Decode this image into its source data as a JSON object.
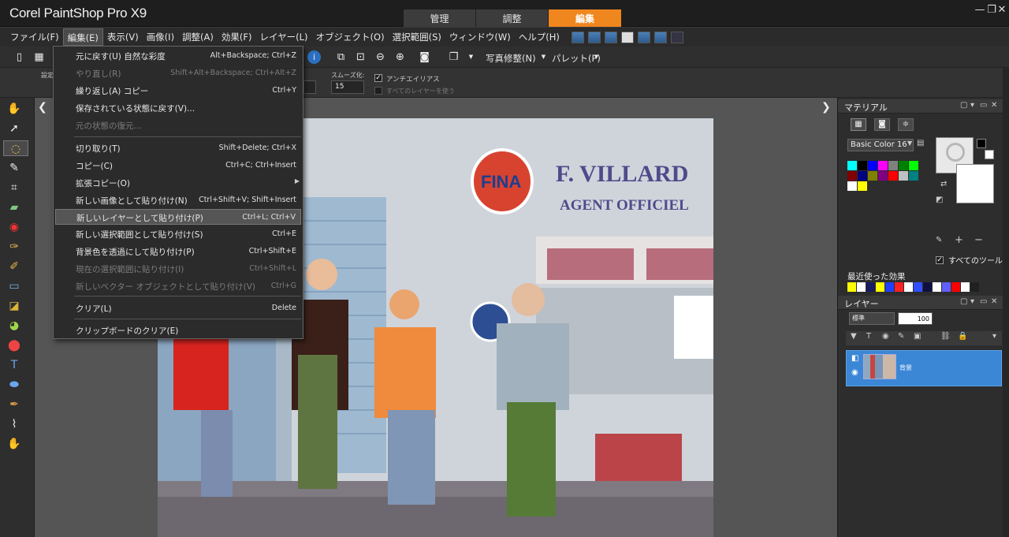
{
  "app": {
    "title": "Corel PaintShop Pro X9",
    "workspace_tabs": [
      {
        "label": "管理"
      },
      {
        "label": "調整"
      },
      {
        "label": "編集"
      }
    ],
    "window_controls": {
      "min": "—",
      "max": "❐",
      "close": "✕"
    }
  },
  "menubar": [
    "ファイル(F)",
    "編集(E)",
    "表示(V)",
    "画像(I)",
    "調整(A)",
    "効果(F)",
    "レイヤー(L)",
    "オブジェクト(O)",
    "選択範囲(S)",
    "ウィンドウ(W)",
    "ヘルプ(H)"
  ],
  "toolbar": {
    "photo_fix": "写真修整(N)",
    "palette": "パレット(P)"
  },
  "options": {
    "preset": "設定",
    "smooth_label": "スムーズ化:",
    "smooth_value": "15",
    "antialias": "アンチエイリアス",
    "use_all_layers": "すべてのレイヤーを使う"
  },
  "edit_menu": [
    {
      "label": "元に戻す(U) 自然な彩度",
      "shortcut": "Alt+Backspace; Ctrl+Z",
      "disabled": false
    },
    {
      "label": "やり直し(R)",
      "shortcut": "Shift+Alt+Backspace; Ctrl+Alt+Z",
      "disabled": true
    },
    {
      "label": "繰り返し(A) コピー",
      "shortcut": "Ctrl+Y",
      "disabled": false
    },
    {
      "label": "保存されている状態に戻す(V)...",
      "shortcut": "",
      "disabled": false
    },
    {
      "label": "元の状態の復元...",
      "shortcut": "",
      "disabled": true
    },
    {
      "label": "切り取り(T)",
      "shortcut": "Shift+Delete; Ctrl+X",
      "disabled": false
    },
    {
      "label": "コピー(C)",
      "shortcut": "Ctrl+C; Ctrl+Insert",
      "disabled": false
    },
    {
      "label": "拡張コピー(O)",
      "shortcut": "",
      "disabled": false
    },
    {
      "label": "新しい画像として貼り付け(N)",
      "shortcut": "Ctrl+Shift+V; Shift+Insert",
      "disabled": false
    },
    {
      "label": "新しいレイヤーとして貼り付け(P)",
      "shortcut": "Ctrl+L; Ctrl+V",
      "disabled": false
    },
    {
      "label": "新しい選択範囲として貼り付け(S)",
      "shortcut": "Ctrl+E",
      "disabled": false
    },
    {
      "label": "背景色を透過にして貼り付け(P)",
      "shortcut": "Ctrl+Shift+E",
      "disabled": false
    },
    {
      "label": "現在の選択範囲に貼り付け(I)",
      "shortcut": "Ctrl+Shift+L",
      "disabled": true
    },
    {
      "label": "新しいベクター オブジェクトとして貼り付け(V)",
      "shortcut": "Ctrl+G",
      "disabled": true
    },
    {
      "label": "クリア(L)",
      "shortcut": "Delete",
      "disabled": false
    },
    {
      "label": "クリップボードのクリア(E)",
      "shortcut": "",
      "disabled": false
    }
  ],
  "materials": {
    "title": "マテリアル",
    "palette_select": "Basic Color 16",
    "all_tools": "すべてのツール",
    "swatches": [
      "#00ffff",
      "#000000",
      "#0000ff",
      "#ff00ff",
      "#808080",
      "#008000",
      "#00ff00",
      "#800000",
      "#000080",
      "#808000",
      "#800080",
      "#ff0000",
      "#c0c0c0",
      "#008080",
      "#ffffff",
      "#ffff00"
    ]
  },
  "recent_effects": {
    "title": "最近使った効果",
    "colors": [
      "#ffff00",
      "#ffffff",
      "#1a1a60",
      "#ffff00",
      "#2040ff",
      "#ff2020",
      "#ffffff",
      "#3050ff",
      "#101040",
      "#ffffff",
      "#6060ff",
      "#ff0000",
      "#ffffff",
      "#202020"
    ]
  },
  "layers": {
    "title": "レイヤー",
    "blend_mode": "標準",
    "opacity": "100",
    "layer_name": "背景"
  }
}
